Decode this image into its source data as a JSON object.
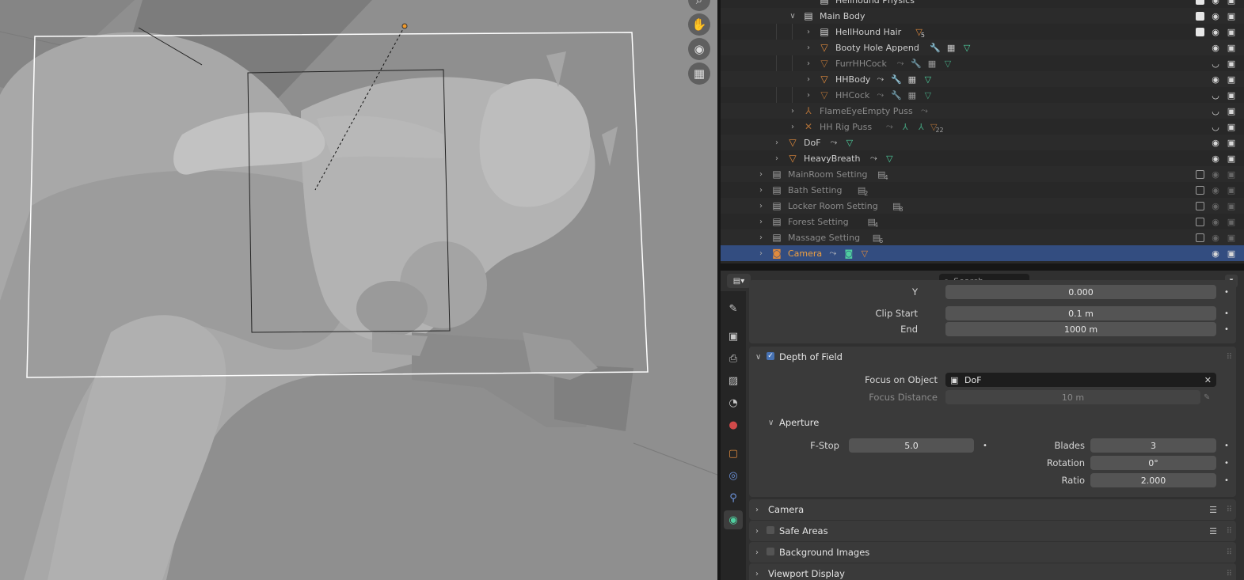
{
  "viewport": {
    "tools": [
      {
        "icon": "zoom-icon",
        "glyph": "⌕"
      },
      {
        "icon": "hand-pan-icon",
        "glyph": "✋"
      },
      {
        "icon": "camera-view-icon",
        "glyph": "◉"
      },
      {
        "icon": "grid-perspective-icon",
        "glyph": "▦"
      }
    ]
  },
  "outliner": {
    "rows": [
      {
        "name": "Hellhound Physics",
        "indent": 4,
        "type": "collection",
        "dim": false,
        "expanded": null,
        "cb": true
      },
      {
        "name": "Main Body",
        "indent": 3,
        "type": "collection",
        "dim": false,
        "expanded": true,
        "cb": true
      },
      {
        "name": "HellHound Hair",
        "indent": 4,
        "type": "collection",
        "dim": false,
        "expanded": false,
        "cb": true,
        "subs": [
          {
            "icon": "mesh-icon",
            "color": "#e08a3c",
            "count": "5"
          }
        ]
      },
      {
        "name": "Booty Hole Append",
        "indent": 4,
        "type": "mesh",
        "dim": false,
        "expanded": false,
        "subs": [
          {
            "icon": "wrench-icon",
            "color": "#6e96e0"
          },
          {
            "icon": "vertex-groups-icon",
            "color": "#c8c8c8"
          },
          {
            "icon": "mesh-data-icon",
            "color": "#4fcf9f"
          }
        ]
      },
      {
        "name": "FurrHHCock",
        "indent": 4,
        "type": "mesh",
        "dim": true,
        "expanded": false,
        "subs": [
          {
            "icon": "constraint-icon",
            "color": "#a0a0a0"
          },
          {
            "icon": "wrench-icon",
            "color": "#6e96e0"
          },
          {
            "icon": "vertex-groups-icon",
            "color": "#c8c8c8"
          },
          {
            "icon": "mesh-data-icon",
            "color": "#4fcf9f"
          }
        ]
      },
      {
        "name": "HHBody",
        "indent": 4,
        "type": "mesh",
        "dim": false,
        "expanded": false,
        "subs": [
          {
            "icon": "constraint-icon",
            "color": "#c8c8c8"
          },
          {
            "icon": "wrench-icon",
            "color": "#6e96e0"
          },
          {
            "icon": "vertex-groups-icon",
            "color": "#c8c8c8"
          },
          {
            "icon": "mesh-data-icon",
            "color": "#4fcf9f"
          }
        ]
      },
      {
        "name": "HHCock",
        "indent": 4,
        "type": "mesh",
        "dim": true,
        "expanded": false,
        "subs": [
          {
            "icon": "constraint-icon",
            "color": "#a0a0a0"
          },
          {
            "icon": "wrench-icon",
            "color": "#6e96e0"
          },
          {
            "icon": "vertex-groups-icon",
            "color": "#c8c8c8"
          },
          {
            "icon": "mesh-data-icon",
            "color": "#4fcf9f"
          }
        ]
      },
      {
        "name": "FlameEyeEmpty Puss",
        "indent": 3,
        "type": "empty",
        "dim": true,
        "expanded": false,
        "subs": [
          {
            "icon": "constraint-icon",
            "color": "#a0a0a0"
          }
        ]
      },
      {
        "name": "HH Rig Puss",
        "indent": 3,
        "type": "armature",
        "dim": true,
        "expanded": false,
        "subs": [
          {
            "icon": "constraint-icon",
            "color": "#a0a0a0"
          },
          {
            "icon": "armature-data-icon",
            "color": "#4fcf9f"
          },
          {
            "icon": "pose-icon",
            "color": "#4fcf9f"
          },
          {
            "icon": "mesh-icon",
            "color": "#e08a3c",
            "count": "22"
          }
        ]
      },
      {
        "name": "DoF",
        "indent": 2,
        "type": "mesh",
        "dim": false,
        "expanded": false,
        "subs": [
          {
            "icon": "constraint-icon",
            "color": "#c8c8c8"
          },
          {
            "icon": "mesh-data-icon",
            "color": "#4fcf9f"
          }
        ]
      },
      {
        "name": "HeavyBreath",
        "indent": 2,
        "type": "mesh",
        "dim": false,
        "expanded": false,
        "subs": [
          {
            "icon": "constraint-icon",
            "color": "#c8c8c8"
          },
          {
            "icon": "mesh-data-icon",
            "color": "#4fcf9f"
          }
        ]
      },
      {
        "name": "MainRoom Setting",
        "indent": 1,
        "type": "collection",
        "dim": true,
        "expanded": false,
        "cb": false,
        "subs": [
          {
            "icon": "collection-icon",
            "color": "#c8c8c8",
            "count": "4"
          }
        ]
      },
      {
        "name": "Bath Setting",
        "indent": 1,
        "type": "collection",
        "dim": true,
        "expanded": false,
        "cb": false,
        "subs": [
          {
            "icon": "collection-icon",
            "color": "#c8c8c8",
            "count": "2"
          }
        ]
      },
      {
        "name": "Locker Room Setting",
        "indent": 1,
        "type": "collection",
        "dim": true,
        "expanded": false,
        "cb": false,
        "subs": [
          {
            "icon": "collection-icon",
            "color": "#c8c8c8",
            "count": "8"
          }
        ]
      },
      {
        "name": "Forest Setting",
        "indent": 1,
        "type": "collection",
        "dim": true,
        "expanded": false,
        "cb": false,
        "subs": [
          {
            "icon": "collection-icon",
            "color": "#c8c8c8",
            "count": "4"
          }
        ]
      },
      {
        "name": "Massage Setting",
        "indent": 1,
        "type": "collection",
        "dim": true,
        "expanded": false,
        "cb": false,
        "subs": [
          {
            "icon": "collection-icon",
            "color": "#c8c8c8",
            "count": "6"
          }
        ]
      },
      {
        "name": "Camera",
        "indent": 1,
        "type": "camera",
        "dim": false,
        "expanded": false,
        "selected": true,
        "subs": [
          {
            "icon": "constraint-icon",
            "color": "#c8c8c8"
          },
          {
            "icon": "camera-data-icon",
            "color": "#4fcf9f"
          },
          {
            "icon": "mesh-icon",
            "color": "#e08a3c"
          }
        ]
      }
    ]
  },
  "properties": {
    "search_placeholder": "Search",
    "clip_start_label": "Clip Start",
    "clip_start_value": "0.1 m",
    "clip_end_label": "End",
    "clip_end_value": "1000 m",
    "y_label": "Y",
    "y_value": "0.000",
    "dof_title": "Depth of Field",
    "focus_object_label": "Focus on Object",
    "focus_object_value": "DoF",
    "focus_distance_label": "Focus Distance",
    "focus_distance_value": "10 m",
    "aperture_title": "Aperture",
    "fstop_label": "F-Stop",
    "fstop_value": "5.0",
    "blades_label": "Blades",
    "blades_value": "3",
    "rotation_label": "Rotation",
    "rotation_value": "0°",
    "ratio_label": "Ratio",
    "ratio_value": "2.000",
    "camera_panel": "Camera",
    "safe_areas_panel": "Safe Areas",
    "background_images_panel": "Background Images",
    "viewport_display_panel": "Viewport Display"
  },
  "colors": {
    "selection": "#334d80",
    "accent_orange": "#e08a3c",
    "data_green": "#4fcf9f",
    "modifier_blue": "#6e96e0"
  }
}
